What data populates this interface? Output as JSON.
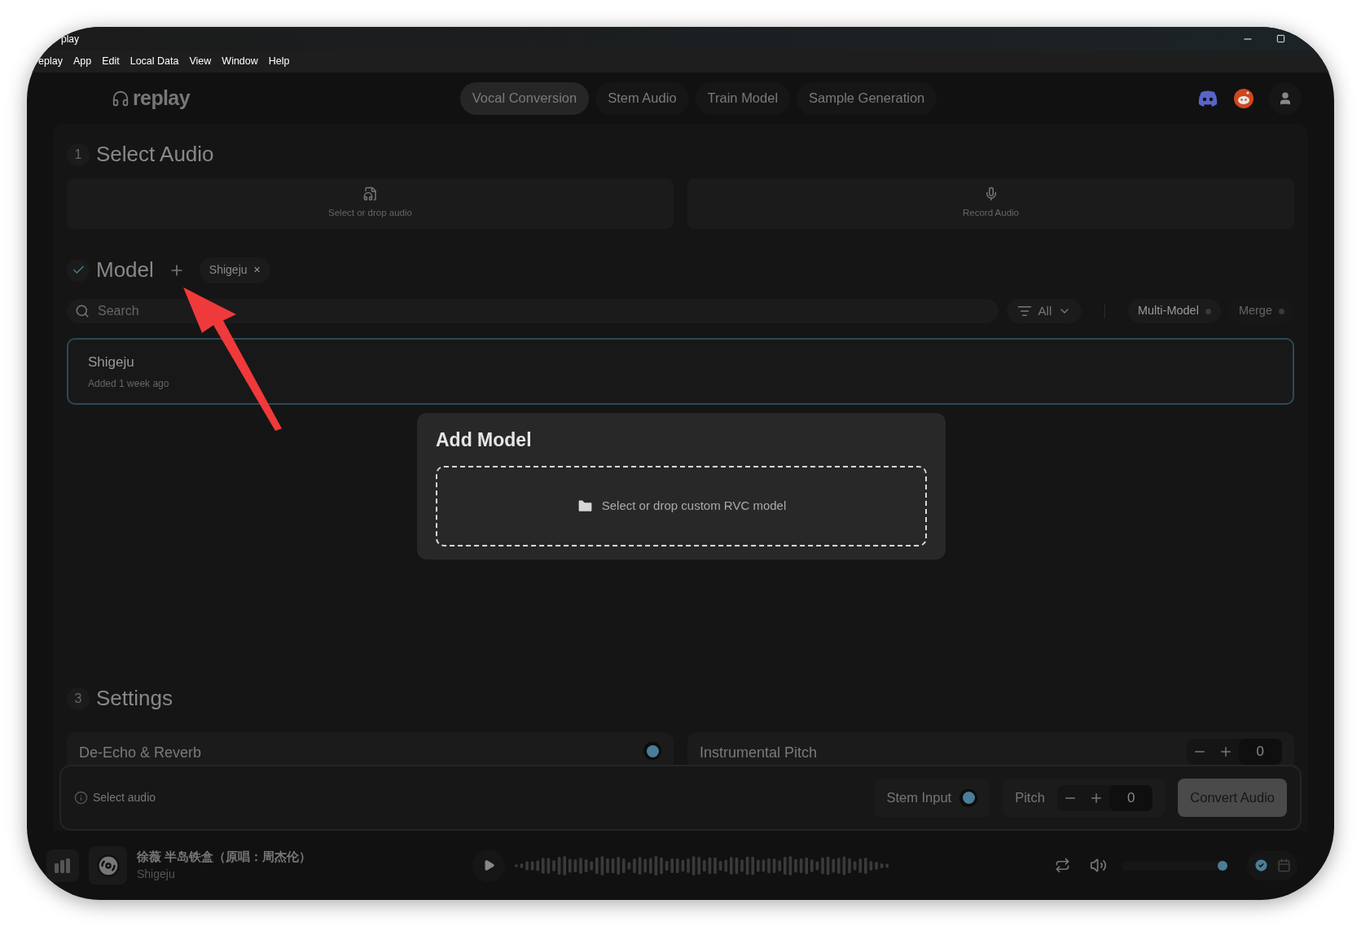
{
  "window": {
    "title": "play"
  },
  "menu": [
    "eplay",
    "App",
    "Edit",
    "Local Data",
    "View",
    "Window",
    "Help"
  ],
  "brand": "replay",
  "tabs": [
    {
      "label": "Vocal Conversion",
      "selected": true
    },
    {
      "label": "Stem Audio",
      "selected": false
    },
    {
      "label": "Train Model",
      "selected": false
    },
    {
      "label": "Sample Generation",
      "selected": false
    }
  ],
  "select_audio": {
    "number": "1",
    "title": "Select Audio",
    "sources": [
      {
        "kind": "file",
        "label": "Select or drop audio"
      },
      {
        "kind": "mic",
        "label": "Record Audio"
      }
    ]
  },
  "model": {
    "title": "Model",
    "done": true,
    "chips": [
      {
        "label": "Shigeju",
        "remove": "×"
      }
    ],
    "search": {
      "placeholder": "Search"
    },
    "filter": "All",
    "options": [
      {
        "label": "Multi-Model",
        "on": false
      },
      {
        "label": "Merge",
        "on": false
      }
    ],
    "list": [
      {
        "name": "Shigeju",
        "meta": "Added 1 week ago",
        "selected": true
      }
    ]
  },
  "settings": {
    "number": "3",
    "title": "Settings",
    "cards": [
      {
        "kind": "toggle",
        "label": "De-Echo & Reverb",
        "on": true
      },
      {
        "kind": "stepper",
        "label": "Instrumental Pitch",
        "value": "0"
      }
    ]
  },
  "action_bar": {
    "hint": "Select audio",
    "stem_input": {
      "label": "Stem Input",
      "on": true
    },
    "pitch": {
      "label": "Pitch",
      "value": "0"
    },
    "convert": "Convert Audio"
  },
  "dialog": {
    "title": "Add Model",
    "dropzone": "Select or drop custom RVC model"
  },
  "player": {
    "title": "徐薇 半岛铁盒（原唱：周杰伦）",
    "subtitle": "Shigeju",
    "volume": {
      "level": 0.95
    }
  }
}
